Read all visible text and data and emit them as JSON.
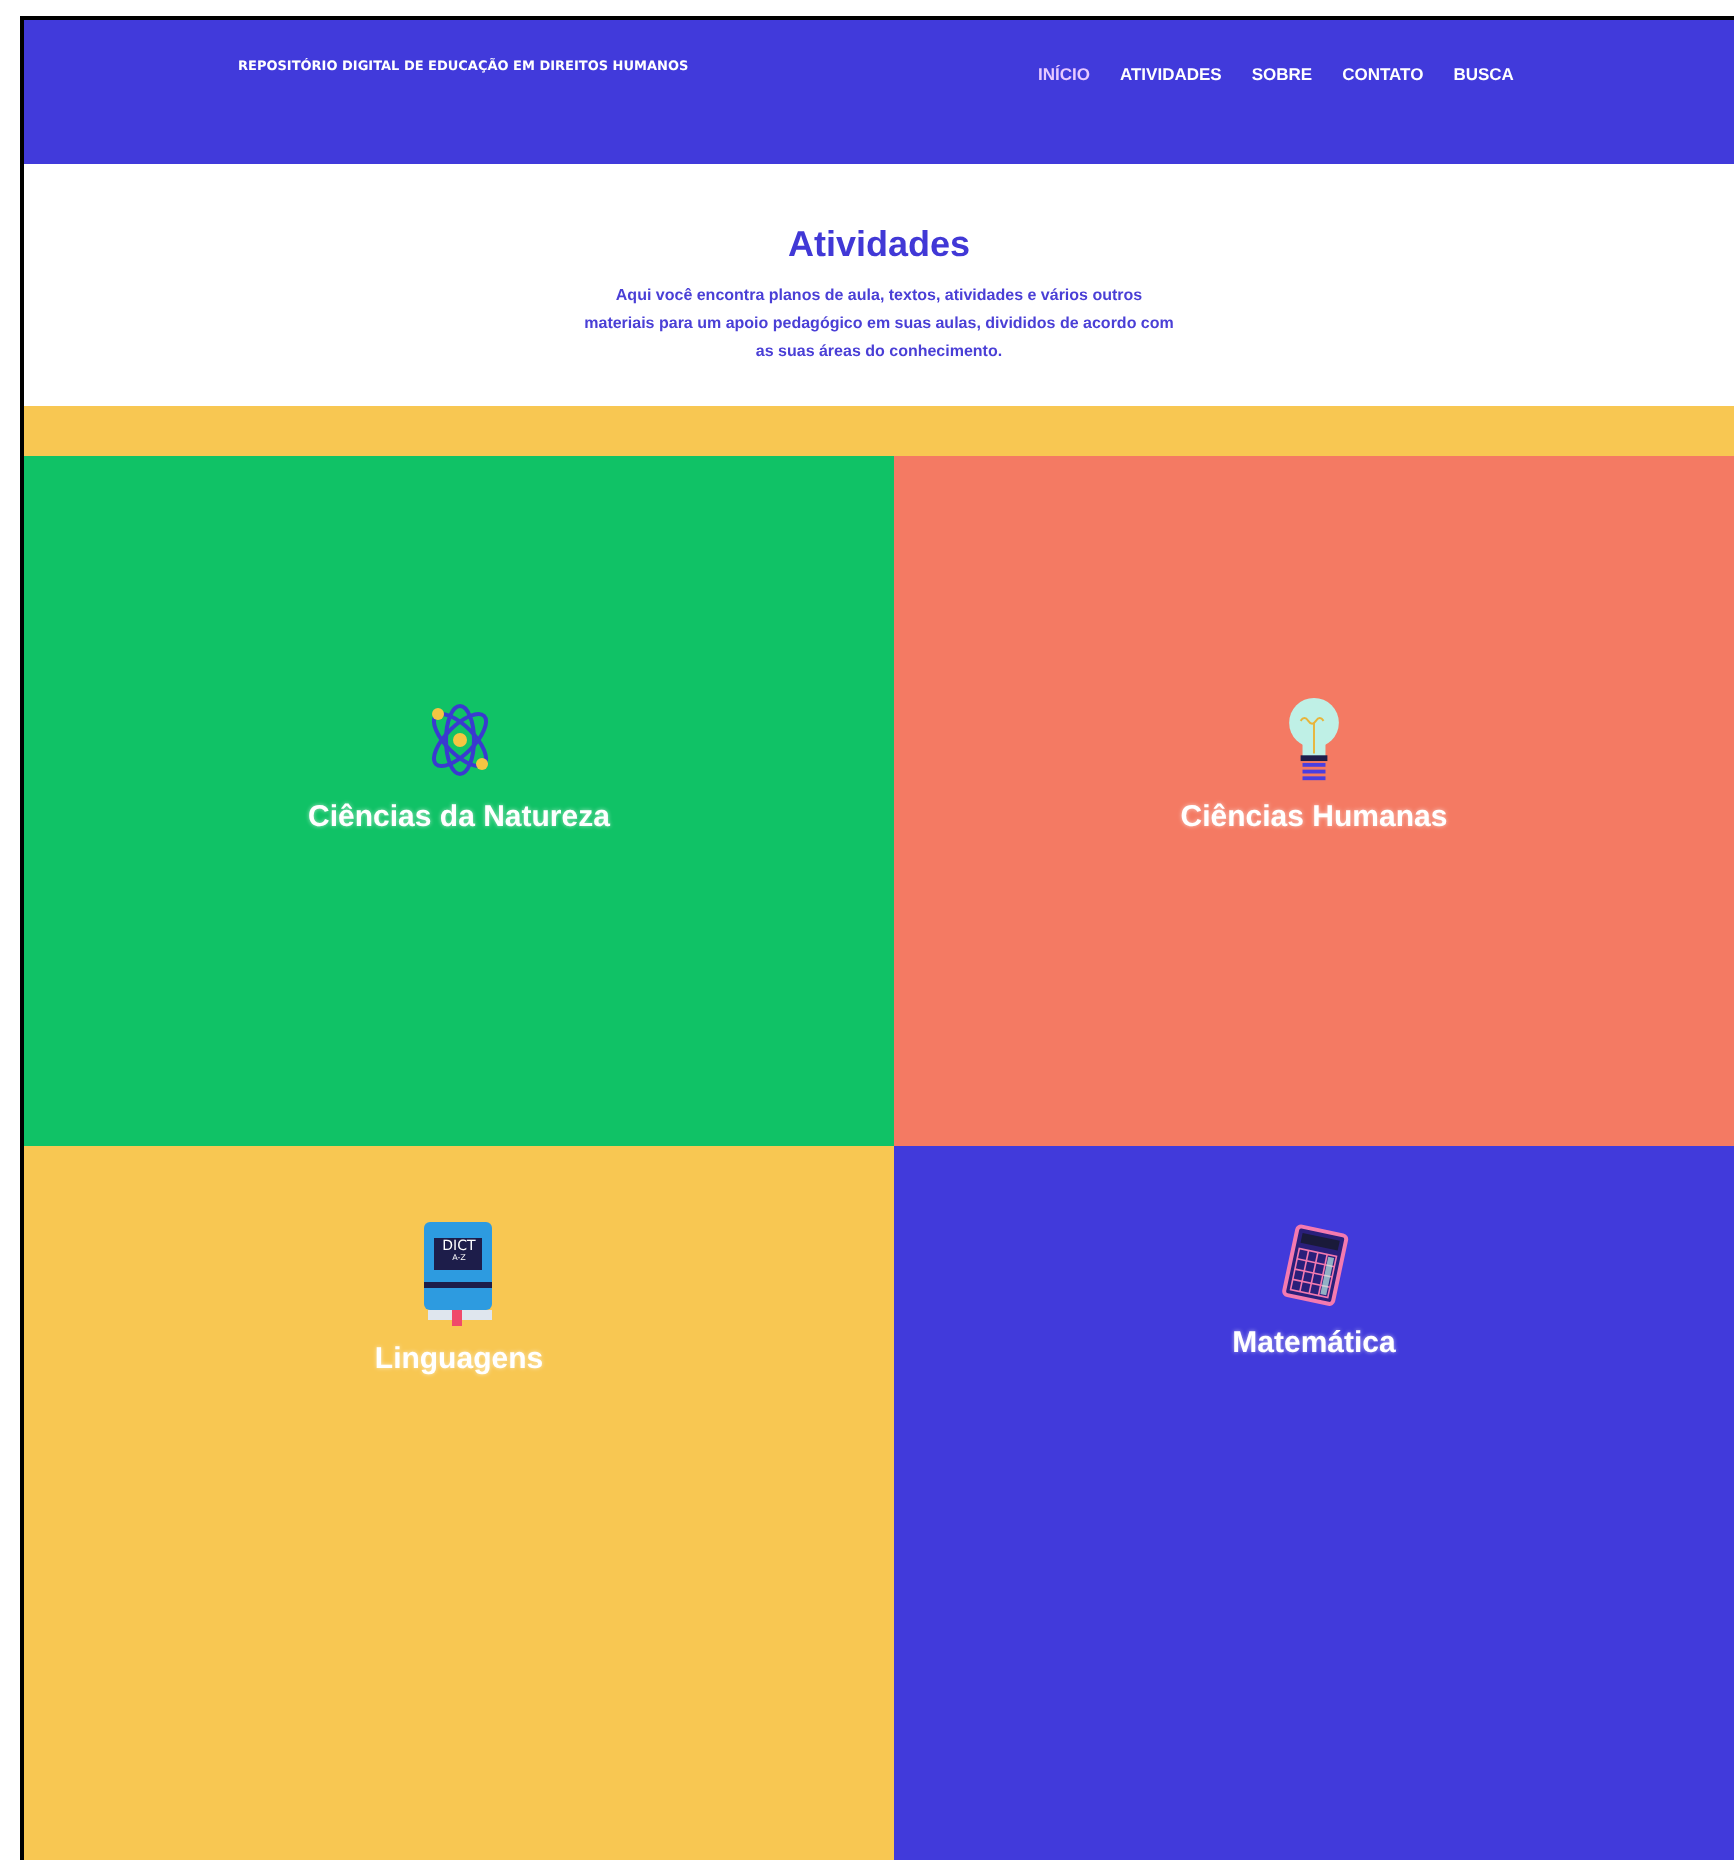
{
  "header": {
    "site_title": "REPOSITÓRIO DIGITAL DE EDUCAÇÃO EM DIREITOS HUMANOS",
    "nav": [
      {
        "label": "INÍCIO",
        "selected": true
      },
      {
        "label": "ATIVIDADES",
        "selected": false
      },
      {
        "label": "SOBRE",
        "selected": false
      },
      {
        "label": "CONTATO",
        "selected": false
      },
      {
        "label": "BUSCA",
        "selected": false
      }
    ]
  },
  "intro": {
    "title": "Atividades",
    "text": "Aqui você encontra planos de aula, textos, atividades e vários outros materiais para um apoio pedagógico em suas aulas, divididos de acordo com as suas áreas do conhecimento."
  },
  "areas": [
    {
      "label": "Ciências da Natureza",
      "kind": "atom",
      "color": "#10c266"
    },
    {
      "label": "Ciências Humanas",
      "kind": "bulb",
      "color": "#f47a63"
    },
    {
      "label": "Linguagens",
      "kind": "book",
      "color": "#f8c752",
      "icon_text": [
        "DICT",
        "A-Z"
      ]
    },
    {
      "label": "Matemática",
      "kind": "calculator",
      "color": "#413adb"
    }
  ]
}
